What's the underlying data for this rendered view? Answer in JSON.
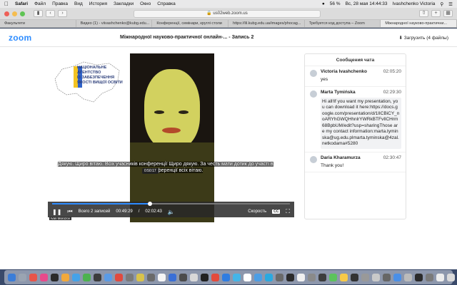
{
  "menubar": {
    "app": "Safari",
    "items": [
      "Файл",
      "Правка",
      "Вид",
      "История",
      "Закладки",
      "Окно",
      "Справка"
    ],
    "battery": "56 %",
    "datetime": "Вс, 28 мая  14:44:33",
    "user": "Ivashchenko Victoria"
  },
  "browser": {
    "url": "us02web.zoom.us",
    "tabs": [
      {
        "label": "Факультети",
        "active": false
      },
      {
        "label": "Видео (1) - viivashchenko@kubg.edu...",
        "active": false
      },
      {
        "label": "Конференції, семінари, круглі столи",
        "active": false
      },
      {
        "label": "https://lil.kubg.edu.ua/images/phocag...",
        "active": false
      },
      {
        "label": "Требуется код доступа – Zoom",
        "active": false
      },
      {
        "label": "Міжнародної науково-практични...",
        "active": true
      }
    ]
  },
  "zoom": {
    "logo": "zoom",
    "title": "Міжнародної науково-практичної онлайн-... - Запись 2",
    "download_label": "Загрузить (4 файлы)"
  },
  "video": {
    "agency_lines": [
      "НАЦІОНАЛЬНЕ",
      "АГЕНТСТВО",
      "ІЗ ЗАБЕЗПЕЧЕННЯ",
      "ЯКОСТІ ВИЩОЇ ОСВІТИ"
    ],
    "subtitle_line1": "Дякую. Щиро вітаю. Всіх учасників конференції Щиро дякую. За честь мати дотик до участі в",
    "subtitle_line2": "конференції всіх вітаю.",
    "tooltip": "0:50:17",
    "progress_fraction": 0.41,
    "records_label": "Всего 2 записей",
    "current_time": "00:49:29",
    "time_sep": "/",
    "total_time": "02:02:43",
    "speed_label": "Скорость",
    "cc_label": "CC",
    "cam_label": "Ivan Morozov"
  },
  "chat": {
    "title": "Сообщения чата",
    "messages": [
      {
        "name": "Victoria Ivashchenko",
        "time": "02:05:20",
        "text": "yes"
      },
      {
        "name": "Marta Tymińska",
        "time": "02:29:30",
        "text": "Hi all!If you want my presentation, you can download it here:https://docs.google.com/presentation/d/1lICBiCY_noARYhGWQHhnlrYWRkBTFvIlCHrm68BpbUM/edit?usp=sharingThose are my contact information:marta.tyminska@ug.edu.plmarta.tyminska@4zal.netkodama#5280"
      },
      {
        "name": "Daria Kharamurza",
        "time": "02:30:47",
        "text": "Thank you!"
      }
    ]
  },
  "colors": {
    "accent": "#2d8cff",
    "progress_bg": "#777777",
    "controls_bg": "#282828"
  },
  "dock_icon_colors": [
    "#3b7dd8",
    "#9aa4b2",
    "#e7554a",
    "#e84a8b",
    "#2b2b2b",
    "#f2a93b",
    "#44a2e8",
    "#4db24f",
    "#3c3c3c",
    "#5a9be6",
    "#e04a3f",
    "#7a7a7a",
    "#d9c34b",
    "#6a6a6a",
    "#f5f5f5",
    "#3a6fd6",
    "#4c4c4c",
    "#d8d8d8",
    "#222222",
    "#e34b3c",
    "#2f7de1",
    "#44b5e8",
    "#ffffff",
    "#4b9ee5",
    "#2aa9e0",
    "#6a6a6a",
    "#2b2b2b",
    "#f0f0f0",
    "#8a8a8a",
    "#3d3d3d",
    "#5cc35c",
    "#f7c948",
    "#333333",
    "#999999",
    "#c9c9c9",
    "#666666",
    "#4a8fe7",
    "#bbbbbb",
    "#2b2b2b",
    "#7a7a7a",
    "#ececec",
    "#dadada"
  ]
}
